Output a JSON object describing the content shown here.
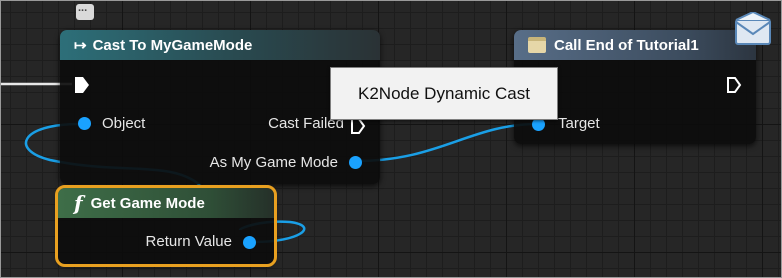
{
  "nodes": {
    "cast": {
      "title": "Cast To MyGameMode",
      "title_icon": "↦",
      "pins": {
        "object": "Object",
        "cast_failed": "Cast Failed",
        "as_my_game_mode": "As My Game Mode"
      }
    },
    "call": {
      "title": "Call End of Tutorial1",
      "pins": {
        "target": "Target"
      }
    },
    "get_game_mode": {
      "title": "Get Game Mode",
      "func_symbol": "f",
      "pins": {
        "return_value": "Return Value"
      }
    }
  },
  "tooltip": {
    "text": "K2Node Dynamic Cast"
  },
  "colors": {
    "object_pin": "#1aa2ff",
    "selection_outline": "#e8a020",
    "grid_background": "#262626"
  },
  "icons": [
    "comment-bubble-icon",
    "envelope-icon",
    "exec-pin-icon",
    "function-icon",
    "event-icon"
  ]
}
